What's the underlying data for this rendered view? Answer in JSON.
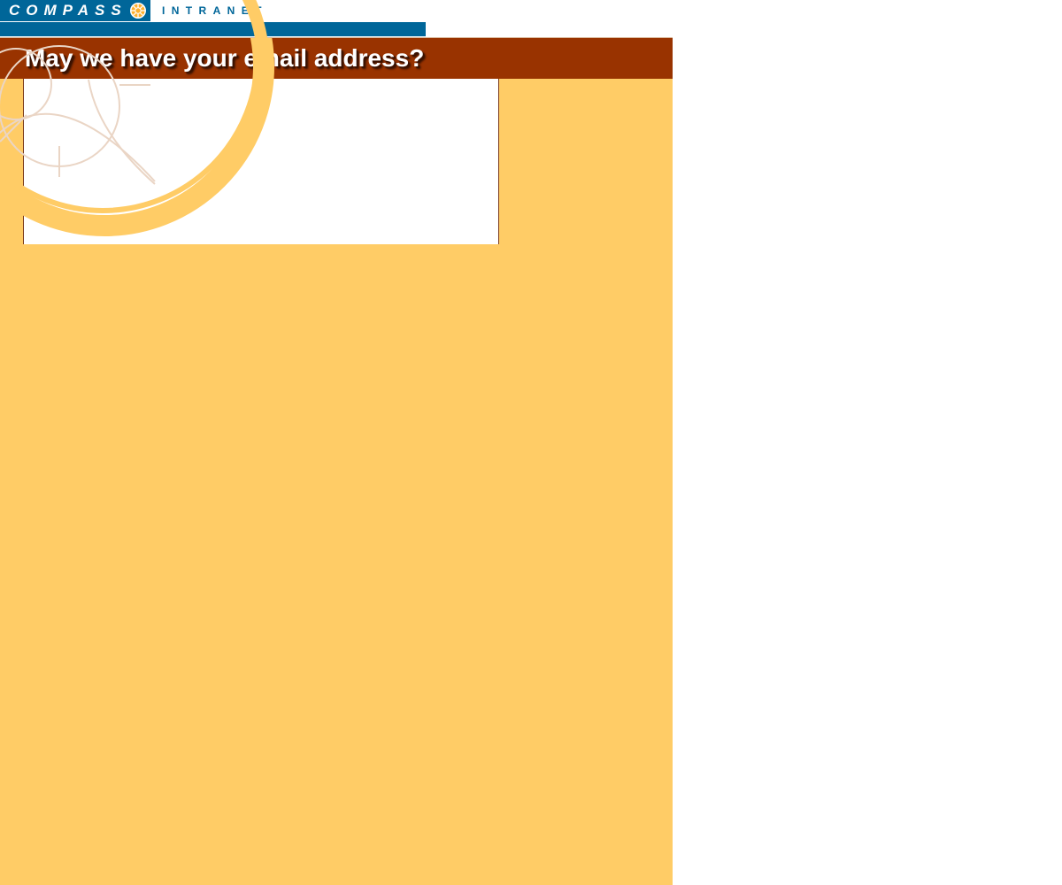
{
  "header": {
    "logo_compass": "COMPASS",
    "logo_intranet": "INTRANET"
  },
  "banner": {
    "title": "May we have your email address?"
  },
  "colors": {
    "page_background": "#ffcc66",
    "brand_blue": "#006699",
    "banner_brown": "#993300",
    "accent_orange": "#ffcc66",
    "line_art": "#e8d3c3"
  },
  "icons": {
    "logo_mark": "sun-icon",
    "background_art": "compass-art"
  }
}
